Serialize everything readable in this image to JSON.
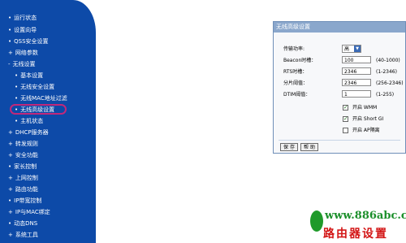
{
  "sidebar": {
    "items": [
      {
        "label": "运行状态"
      },
      {
        "label": "设置向导"
      },
      {
        "label": "QSS安全设置"
      },
      {
        "label": "网络参数"
      },
      {
        "label": "无线设置"
      },
      {
        "label": "基本设置"
      },
      {
        "label": "无线安全设置"
      },
      {
        "label": "无线MAC地址过滤"
      },
      {
        "label": "无线高级设置"
      },
      {
        "label": "主机状态"
      },
      {
        "label": "DHCP服务器"
      },
      {
        "label": "转发规则"
      },
      {
        "label": "安全功能"
      },
      {
        "label": "家长控制"
      },
      {
        "label": "上网控制"
      },
      {
        "label": "路由功能"
      },
      {
        "label": "IP带宽控制"
      },
      {
        "label": "IP与MAC绑定"
      },
      {
        "label": "动态DNS"
      },
      {
        "label": "系统工具"
      }
    ]
  },
  "panel": {
    "title": "无线高级设置",
    "tx_power_label": "传输功率:",
    "tx_power_value": "高",
    "beacon_label": "Beacon时槽：",
    "beacon_value": "100",
    "beacon_hint": "(40-1000)",
    "rts_label": "RTS时槽：",
    "rts_value": "2346",
    "rts_hint": "(1-2346)",
    "frag_label": "分片阈值：",
    "frag_value": "2346",
    "frag_hint": "(256-2346)",
    "dtim_label": "DTIM阈值：",
    "dtim_value": "1",
    "dtim_hint": "(1-255)",
    "wmm_label": "开启 WMM",
    "shortgi_label": "开启 Short GI",
    "ap_isolation_label": "开启 AP隔离",
    "save_label": "保 存",
    "help_label": "帮 助"
  },
  "watermark": {
    "url": "www.886abc.com",
    "text": "路由器设置"
  }
}
